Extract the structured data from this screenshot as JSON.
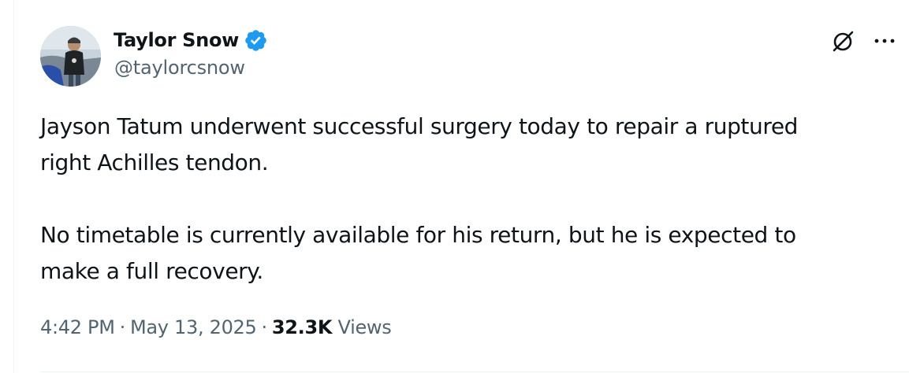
{
  "author": {
    "display_name": "Taylor Snow",
    "handle": "@taylorcsnow",
    "verified": true
  },
  "tweet": {
    "paragraphs": [
      "Jayson Tatum underwent successful surgery today to repair a ruptured\nright Achilles tendon.",
      "No timetable is currently available for his return, but he is expected to\nmake a full recovery."
    ]
  },
  "meta": {
    "time": "4:42 PM",
    "separator": "·",
    "date": "May 13, 2025",
    "views_count": "32.3K",
    "views_label": "Views"
  },
  "icons": {
    "verified": "verified-badge-icon",
    "grok": "grok-icon",
    "more": "more-icon"
  },
  "colors": {
    "verified_blue": "#1d9bf0",
    "text_primary": "#0f1419",
    "text_secondary": "#536471"
  }
}
